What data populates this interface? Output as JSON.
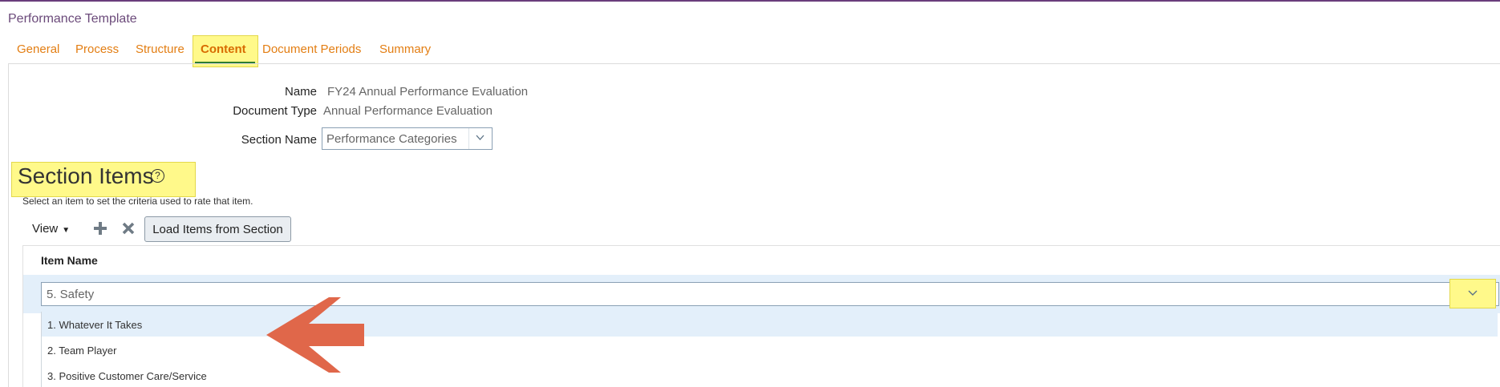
{
  "app": {
    "title": "Performance Template"
  },
  "tabs": [
    {
      "label": "General",
      "active": false
    },
    {
      "label": "Process",
      "active": false
    },
    {
      "label": "Structure",
      "active": false
    },
    {
      "label": "Content",
      "active": true
    },
    {
      "label": "Document Periods",
      "active": false
    },
    {
      "label": "Summary",
      "active": false
    }
  ],
  "form": {
    "name_label": "Name",
    "name_value": "FY24 Annual Performance Evaluation",
    "doctype_label": "Document Type",
    "doctype_value": "Annual Performance Evaluation",
    "section_label": "Section Name",
    "section_value": "Performance Categories"
  },
  "section_items": {
    "title": "Section Items",
    "help_icon": "help-circle-icon",
    "hint": "Select an item to set the criteria used to rate that item."
  },
  "toolbar": {
    "view_label": "View",
    "add_icon": "plus-icon",
    "delete_icon": "x-icon",
    "load_label": "Load Items from Section"
  },
  "grid": {
    "column_header": "Item Name",
    "selected_value": "5. Safety",
    "options": [
      "1. Whatever It Takes",
      "2. Team Player",
      "3. Positive Customer Care/Service"
    ]
  },
  "colors": {
    "tab": "#e37e13",
    "highlight": "#fff98a",
    "selected_row": "#e3effa",
    "annotation_arrow": "#e0674a",
    "active_underline": "#2e7d32"
  }
}
